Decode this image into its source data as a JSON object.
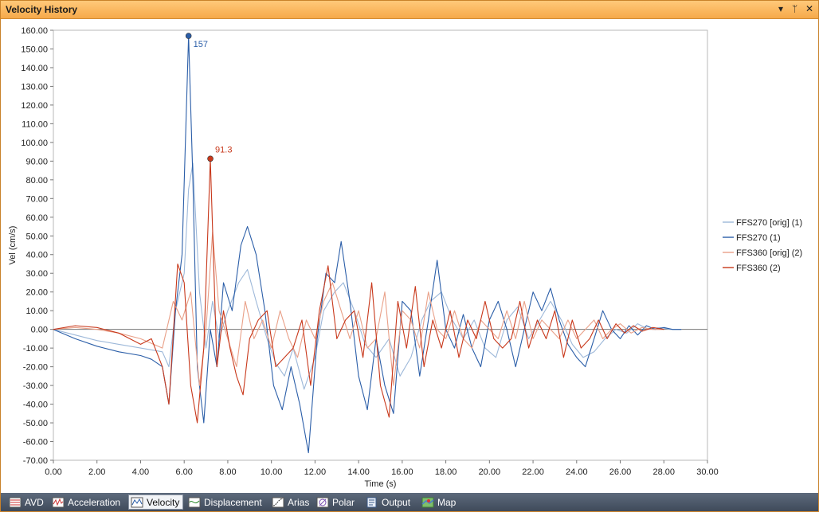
{
  "window": {
    "title": "Velocity History",
    "controls": {
      "dropdown": "▾",
      "pin": "ᛘ",
      "close": "✕"
    }
  },
  "tabs": [
    {
      "label": "AVD",
      "icon": "avd-icon",
      "active": false
    },
    {
      "label": "Acceleration",
      "icon": "acceleration-icon",
      "active": false
    },
    {
      "label": "Velocity",
      "icon": "velocity-icon",
      "active": true
    },
    {
      "label": "Displacement",
      "icon": "displacement-icon",
      "active": false
    },
    {
      "label": "Arias",
      "icon": "arias-icon",
      "active": false
    },
    {
      "label": "Polar",
      "icon": "polar-icon",
      "active": false
    },
    {
      "label": "Output",
      "icon": "output-icon",
      "active": false
    },
    {
      "label": "Map",
      "icon": "map-icon",
      "active": false
    }
  ],
  "colors": {
    "title_bar": "#f6a94a",
    "tab_bar": "#4a5566",
    "series_blue": "#2b5ea8",
    "series_blue_light": "#9db8d9",
    "series_red": "#c8381b",
    "series_red_light": "#e9a088"
  },
  "chart_data": {
    "type": "line",
    "xlabel": "Time (s)",
    "ylabel": "Vel (cm/s)",
    "xlim": [
      0,
      30
    ],
    "ylim": [
      -70,
      160
    ],
    "x_ticks": [
      "0.00",
      "2.00",
      "4.00",
      "6.00",
      "8.00",
      "10.00",
      "12.00",
      "14.00",
      "16.00",
      "18.00",
      "20.00",
      "22.00",
      "24.00",
      "26.00",
      "28.00",
      "30.00"
    ],
    "y_ticks": [
      "160.00",
      "150.00",
      "140.00",
      "130.00",
      "120.00",
      "110.00",
      "100.00",
      "90.00",
      "80.00",
      "70.00",
      "60.00",
      "50.00",
      "40.00",
      "30.00",
      "20.00",
      "10.00",
      "0.00",
      "-10.00",
      "-20.00",
      "-30.00",
      "-40.00",
      "-50.00",
      "-60.00",
      "-70.00"
    ],
    "legend_position": "right",
    "series": [
      {
        "name": "FFS270 [orig]  (1)",
        "color": "#9db8d9",
        "x": [
          0,
          1,
          2,
          3,
          4,
          5,
          5.3,
          5.6,
          6,
          6.2,
          6.4,
          6.7,
          7.0,
          7.3,
          7.6,
          8.0,
          8.5,
          8.9,
          9.3,
          9.8,
          10.2,
          10.6,
          11.0,
          11.5,
          12.0,
          12.4,
          12.9,
          13.3,
          13.8,
          14.3,
          14.8,
          15.4,
          15.9,
          16.4,
          16.9,
          17.3,
          17.8,
          18.3,
          18.8,
          19.3,
          19.8,
          20.3,
          20.8,
          21.3,
          21.8,
          22.3,
          22.8,
          23.3,
          23.8,
          24.3,
          24.8,
          25.3,
          25.8,
          26.3,
          26.8,
          27.3,
          27.8,
          28.3,
          28.8
        ],
        "y": [
          0,
          -3,
          -6,
          -8,
          -10,
          -12,
          -20,
          10,
          30,
          75,
          89,
          20,
          -10,
          15,
          -5,
          10,
          25,
          32,
          15,
          -5,
          -18,
          -25,
          -10,
          -32,
          -15,
          10,
          20,
          25,
          10,
          -8,
          -15,
          -5,
          -25,
          -15,
          5,
          15,
          20,
          5,
          -5,
          5,
          -10,
          -15,
          5,
          12,
          -5,
          5,
          15,
          5,
          -8,
          -15,
          -12,
          -5,
          0,
          -2,
          3,
          0,
          1,
          0,
          0
        ]
      },
      {
        "name": "FFS270 (1)",
        "color": "#2b5ea8",
        "x": [
          0,
          1,
          2,
          3,
          4,
          4.5,
          5,
          5.3,
          5.6,
          5.9,
          6.2,
          6.4,
          6.6,
          6.9,
          7.2,
          7.5,
          7.8,
          8.2,
          8.6,
          8.9,
          9.3,
          9.7,
          10.1,
          10.5,
          10.9,
          11.3,
          11.7,
          12.1,
          12.5,
          12.9,
          13.2,
          13.6,
          14.0,
          14.4,
          14.8,
          15.2,
          15.6,
          16.0,
          16.4,
          16.8,
          17.2,
          17.6,
          18.0,
          18.4,
          18.8,
          19.2,
          19.6,
          20.0,
          20.4,
          20.8,
          21.2,
          21.6,
          22.0,
          22.4,
          22.8,
          23.2,
          23.6,
          24.0,
          24.4,
          24.8,
          25.2,
          25.6,
          26.0,
          26.4,
          26.8,
          27.2,
          27.6,
          28.0,
          28.4,
          28.8
        ],
        "y": [
          0,
          -5,
          -9,
          -12,
          -14,
          -16,
          -20,
          -40,
          10,
          40,
          157,
          80,
          -20,
          -50,
          0,
          -20,
          25,
          10,
          45,
          55,
          40,
          10,
          -30,
          -43,
          -20,
          -40,
          -66,
          -5,
          30,
          25,
          47,
          15,
          -25,
          -43,
          -5,
          -30,
          -45,
          15,
          10,
          -25,
          5,
          37,
          0,
          -10,
          8,
          -10,
          -20,
          5,
          15,
          0,
          -20,
          0,
          20,
          10,
          22,
          5,
          -8,
          -15,
          -20,
          -5,
          10,
          0,
          -5,
          2,
          -3,
          2,
          0,
          1,
          0,
          0
        ]
      },
      {
        "name": "FFS360 [orig]  (2)",
        "color": "#e9a088",
        "x": [
          0,
          1,
          2,
          3,
          4,
          5,
          5.5,
          5.9,
          6.3,
          6.7,
          7.0,
          7.3,
          7.6,
          8.0,
          8.4,
          8.8,
          9.2,
          9.6,
          10.0,
          10.4,
          10.8,
          11.2,
          11.6,
          12.0,
          12.4,
          12.8,
          13.2,
          13.6,
          14.0,
          14.4,
          14.8,
          15.2,
          15.6,
          16.0,
          16.4,
          16.8,
          17.2,
          17.6,
          18.0,
          18.4,
          18.8,
          19.2,
          19.6,
          20.0,
          20.4,
          20.8,
          21.2,
          21.6,
          22.0,
          22.4,
          22.8,
          23.2,
          23.6,
          24.0,
          24.4,
          24.8,
          25.2,
          25.6,
          26.0,
          26.5,
          27.0,
          27.5,
          28.0
        ],
        "y": [
          0,
          1,
          0,
          -2,
          -5,
          -10,
          15,
          5,
          20,
          -30,
          0,
          52,
          10,
          -5,
          -20,
          15,
          -5,
          5,
          -10,
          10,
          -5,
          -15,
          5,
          -5,
          15,
          25,
          10,
          -5,
          10,
          -10,
          -5,
          20,
          -30,
          10,
          5,
          -10,
          20,
          0,
          -5,
          10,
          -5,
          -10,
          5,
          0,
          -5,
          10,
          -5,
          15,
          -5,
          5,
          0,
          -5,
          5,
          -5,
          0,
          5,
          -5,
          0,
          3,
          -2,
          1,
          0,
          0
        ]
      },
      {
        "name": "FFS360 (2)",
        "color": "#c8381b",
        "x": [
          0,
          1,
          2,
          3,
          4,
          4.5,
          5,
          5.3,
          5.7,
          6.0,
          6.3,
          6.6,
          6.9,
          7.2,
          7.5,
          7.8,
          8.1,
          8.4,
          8.7,
          9.0,
          9.4,
          9.8,
          10.2,
          10.6,
          11.0,
          11.4,
          11.8,
          12.2,
          12.6,
          13.0,
          13.4,
          13.8,
          14.2,
          14.6,
          15.0,
          15.4,
          15.8,
          16.2,
          16.6,
          17.0,
          17.4,
          17.8,
          18.2,
          18.6,
          19.0,
          19.4,
          19.8,
          20.2,
          20.6,
          21.0,
          21.4,
          21.8,
          22.2,
          22.6,
          23.0,
          23.4,
          23.8,
          24.2,
          24.6,
          25.0,
          25.4,
          25.8,
          26.2,
          26.6,
          27.0,
          27.5,
          28.0
        ],
        "y": [
          0,
          2,
          1,
          -2,
          -8,
          -5,
          -20,
          -40,
          35,
          25,
          -30,
          -50,
          -10,
          91.3,
          -20,
          10,
          -10,
          -25,
          -35,
          -5,
          5,
          10,
          -20,
          -15,
          -10,
          5,
          -30,
          10,
          34,
          -5,
          5,
          10,
          -15,
          25,
          -30,
          -47,
          15,
          -10,
          23,
          -20,
          5,
          -10,
          10,
          -15,
          5,
          -5,
          15,
          -5,
          -10,
          -5,
          15,
          -10,
          5,
          -5,
          10,
          -15,
          5,
          -10,
          -5,
          5,
          -5,
          3,
          -2,
          2,
          -1,
          1,
          0
        ]
      }
    ],
    "annotations": [
      {
        "text": "157",
        "x": 6.2,
        "y": 157,
        "series": "FFS270 (1)"
      },
      {
        "text": "91.3",
        "x": 7.2,
        "y": 91.3,
        "series": "FFS360 (2)"
      }
    ]
  }
}
